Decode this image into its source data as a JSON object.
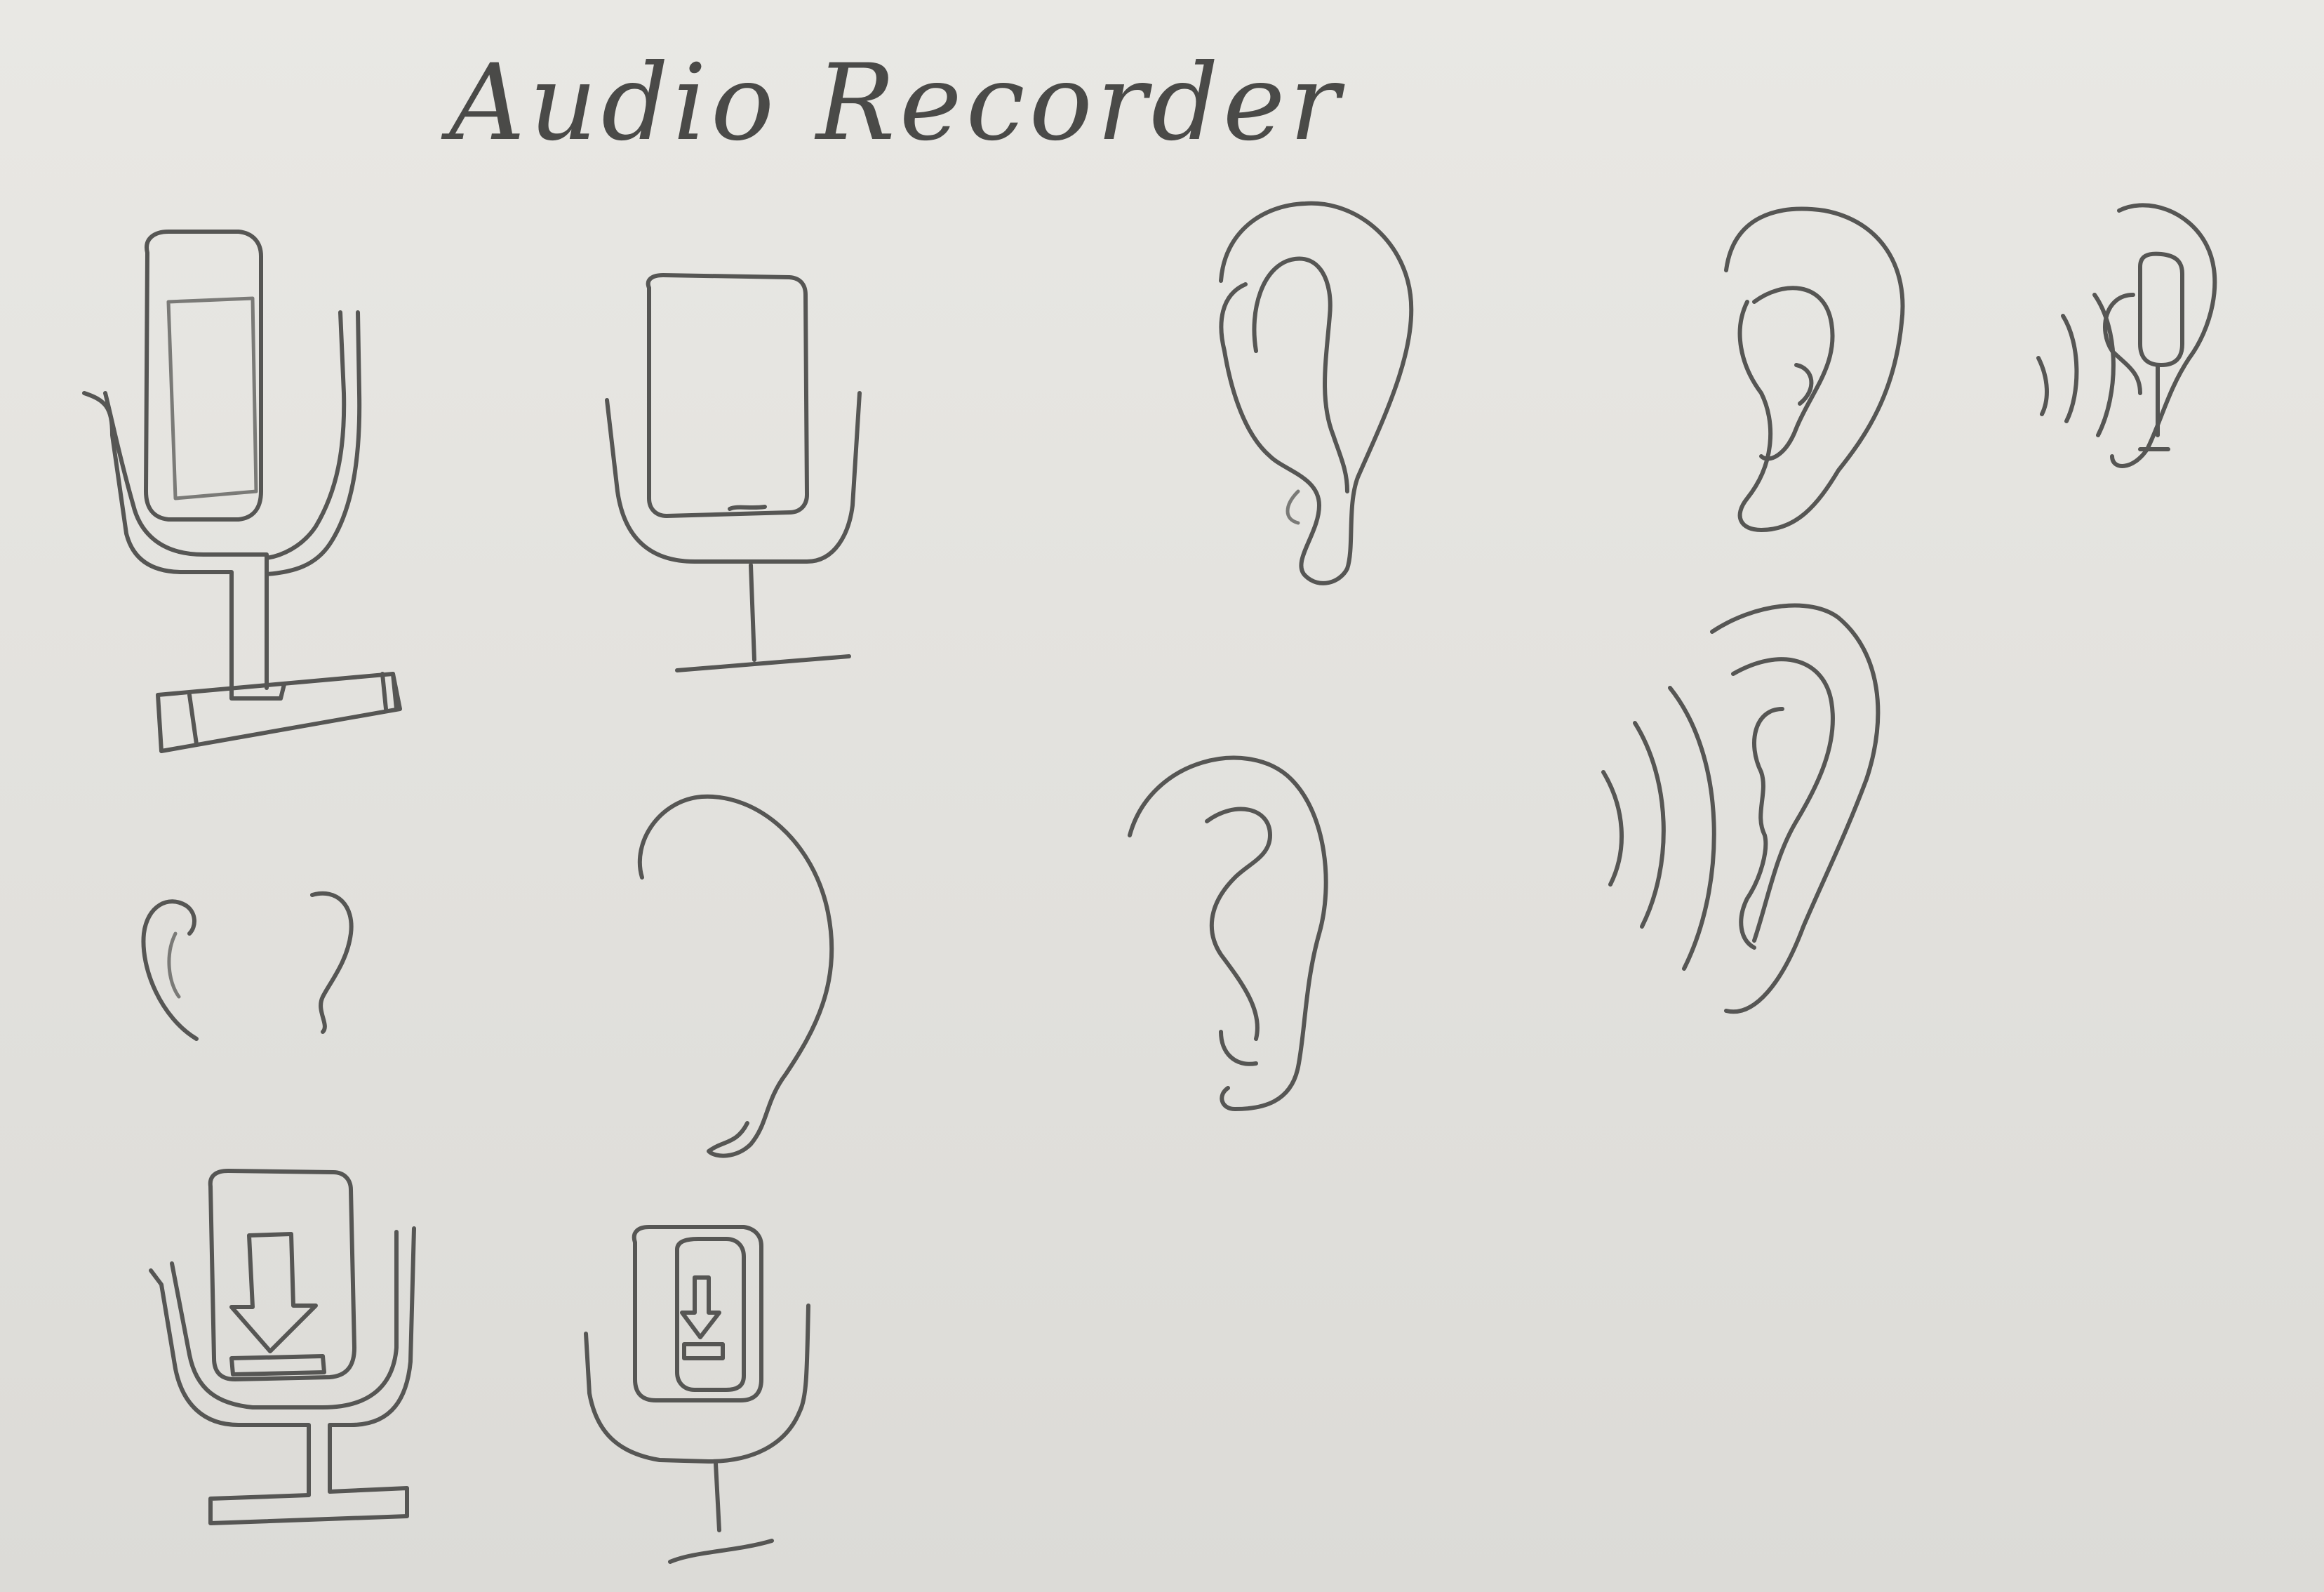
{
  "title": "Audio Recorder",
  "sketches": [
    {
      "name": "microphone-icon",
      "variant": "detailed with stand base"
    },
    {
      "name": "microphone-icon",
      "variant": "simple"
    },
    {
      "name": "ear-icon",
      "variant": "tall outline"
    },
    {
      "name": "ear-icon",
      "variant": "curled"
    },
    {
      "name": "ear-microphone-icon",
      "variant": "with sound waves"
    },
    {
      "name": "ear-pair-icon",
      "variant": "small"
    },
    {
      "name": "ear-icon",
      "variant": "plain outline"
    },
    {
      "name": "ear-icon",
      "variant": "rounded"
    },
    {
      "name": "ear-sound-waves-icon",
      "variant": "with sound waves"
    },
    {
      "name": "microphone-download-icon",
      "variant": "with stand"
    },
    {
      "name": "microphone-download-icon",
      "variant": "small with stand"
    }
  ],
  "colors": {
    "paper": "#e4e3df",
    "pencil": "#565654"
  }
}
